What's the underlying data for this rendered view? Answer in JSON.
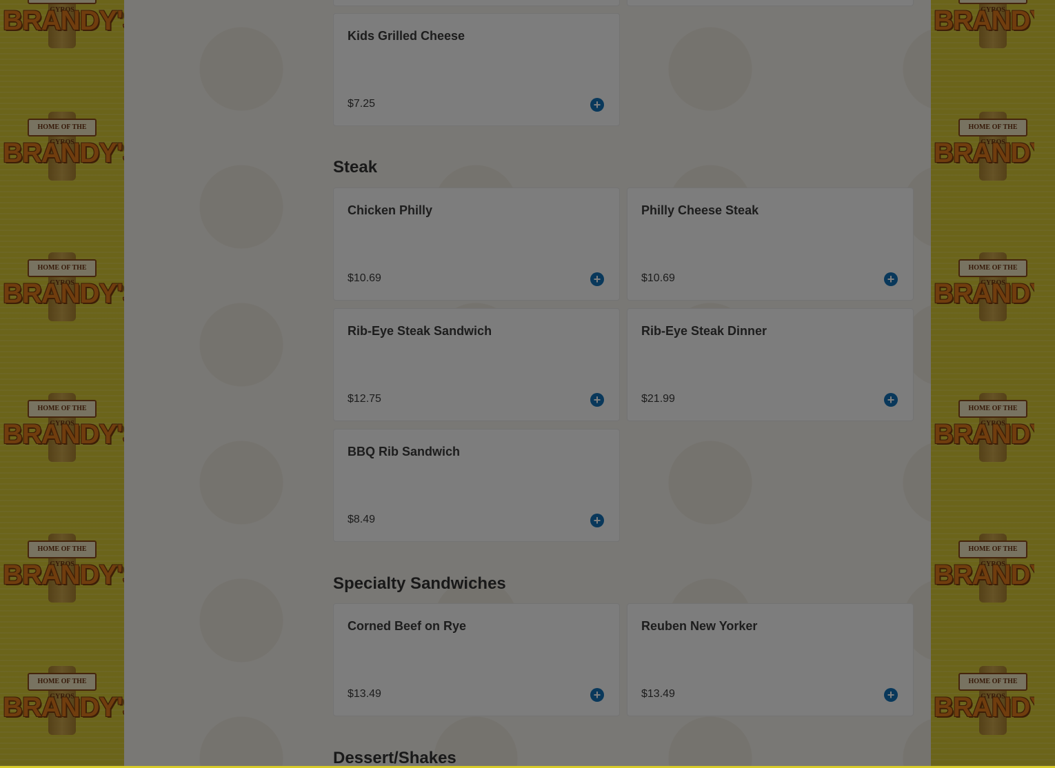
{
  "brand": {
    "logo_banner": "HOME OF THE GYROS",
    "logo_word": "BRANDY'S"
  },
  "colors": {
    "add_button": "#1271b7",
    "overlay": "rgba(0,0,0,0.5)",
    "side_background": "#d6c834"
  },
  "sections": [
    {
      "title": "",
      "items": [
        {
          "name": "Kids Grilled Cheese",
          "price": "$7.25",
          "icon": "plus-circle-icon"
        }
      ]
    },
    {
      "title": "Steak",
      "items": [
        {
          "name": "Chicken Philly",
          "price": "$10.69",
          "icon": "plus-circle-icon"
        },
        {
          "name": "Philly Cheese Steak",
          "price": "$10.69",
          "icon": "plus-circle-icon"
        },
        {
          "name": "Rib-Eye Steak Sandwich",
          "price": "$12.75",
          "icon": "plus-circle-icon"
        },
        {
          "name": "Rib-Eye Steak Dinner",
          "price": "$21.99",
          "icon": "plus-circle-icon"
        },
        {
          "name": "BBQ Rib Sandwich",
          "price": "$8.49",
          "icon": "plus-circle-icon"
        }
      ]
    },
    {
      "title": "Specialty Sandwiches",
      "items": [
        {
          "name": "Corned Beef on Rye",
          "price": "$13.49",
          "icon": "plus-circle-icon"
        },
        {
          "name": "Reuben New Yorker",
          "price": "$13.49",
          "icon": "plus-circle-icon"
        }
      ]
    },
    {
      "title": "Dessert/Shakes",
      "items": []
    }
  ]
}
